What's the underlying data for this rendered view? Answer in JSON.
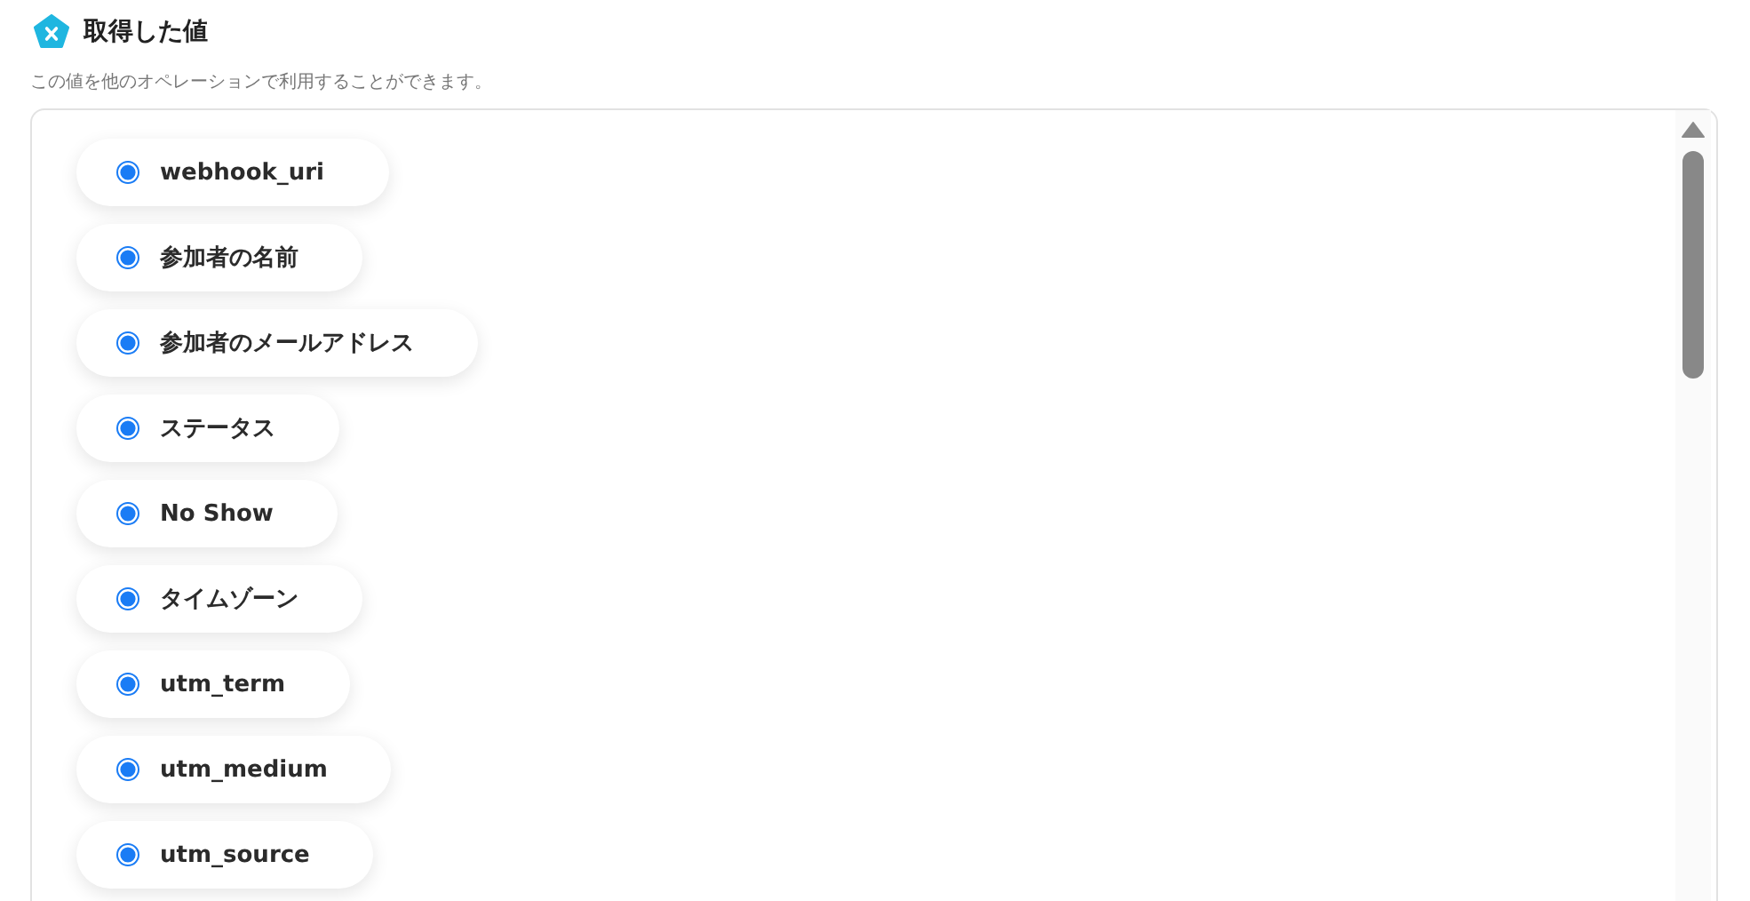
{
  "section": {
    "title": "取得した値",
    "description": "この値を他のオペレーションで利用することができます。"
  },
  "values": [
    {
      "label": "webhook_uri"
    },
    {
      "label": "参加者の名前"
    },
    {
      "label": "参加者のメールアドレス"
    },
    {
      "label": "ステータス"
    },
    {
      "label": "No Show"
    },
    {
      "label": "タイムゾーン"
    },
    {
      "label": "utm_term"
    },
    {
      "label": "utm_medium"
    },
    {
      "label": "utm_source"
    }
  ]
}
